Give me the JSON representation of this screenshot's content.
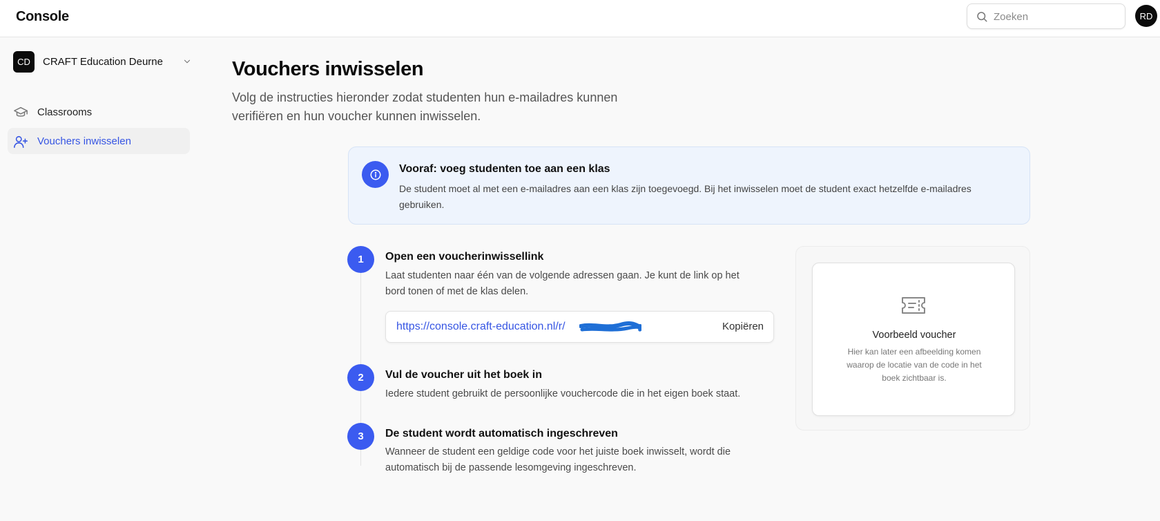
{
  "header": {
    "brand": "Console",
    "search_placeholder": "Zoeken",
    "user_initials": "RD"
  },
  "sidebar": {
    "org_initials": "CD",
    "org_name": "CRAFT Education Deurne",
    "items": [
      {
        "label": "Classrooms",
        "icon": "graduation-cap-icon",
        "active": false
      },
      {
        "label": "Vouchers inwisselen",
        "icon": "user-plus-icon",
        "active": true
      }
    ]
  },
  "main": {
    "title": "Vouchers inwisselen",
    "subtitle": "Volg de instructies hieronder zodat studenten hun e-mailadres kunnen verifiëren en hun voucher kunnen inwisselen.",
    "info": {
      "title": "Vooraf: voeg studenten toe aan een klas",
      "text": "De student moet al met een e-mailadres aan een klas zijn toegevoegd. Bij het inwisselen moet de student exact hetzelfde e-mailadres gebruiken."
    },
    "steps": [
      {
        "number": "1",
        "title": "Open een voucherinwissellink",
        "text": "Laat studenten naar één van de volgende adressen gaan. Je kunt de link op het bord tonen of met de klas delen."
      },
      {
        "number": "2",
        "title": "Vul de voucher uit het boek in",
        "text": "Iedere student gebruikt de persoonlijke vouchercode die in het eigen boek staat."
      },
      {
        "number": "3",
        "title": "De student wordt automatisch ingeschreven",
        "text": "Wanneer de student een geldige code voor het juiste boek inwisselt, wordt die automatisch bij de passende lesomgeving ingeschreven."
      }
    ],
    "link": {
      "url": "https://console.craft-education.nl/r/",
      "copy_label": "Kopiëren"
    },
    "example": {
      "title": "Voorbeeld voucher",
      "text": "Hier kan later een afbeelding komen waarop de locatie van de code in het boek zichtbaar is."
    }
  },
  "colors": {
    "accent": "#3b5bf0",
    "link": "#3655e3",
    "info_bg": "#eef4fd"
  }
}
